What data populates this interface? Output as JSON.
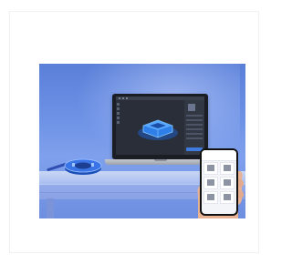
{
  "image": {
    "scene": "",
    "colors": {
      "background": "#ffffff",
      "wall": "#6f93e6",
      "desk": "#a9bdf0",
      "laptop": "#1b1d24",
      "model_accent": "#2f7fe8",
      "app_button": "#3f7ae0"
    }
  },
  "icons": {
    "model": "3d-model-icon",
    "tools": "tool-icon"
  }
}
